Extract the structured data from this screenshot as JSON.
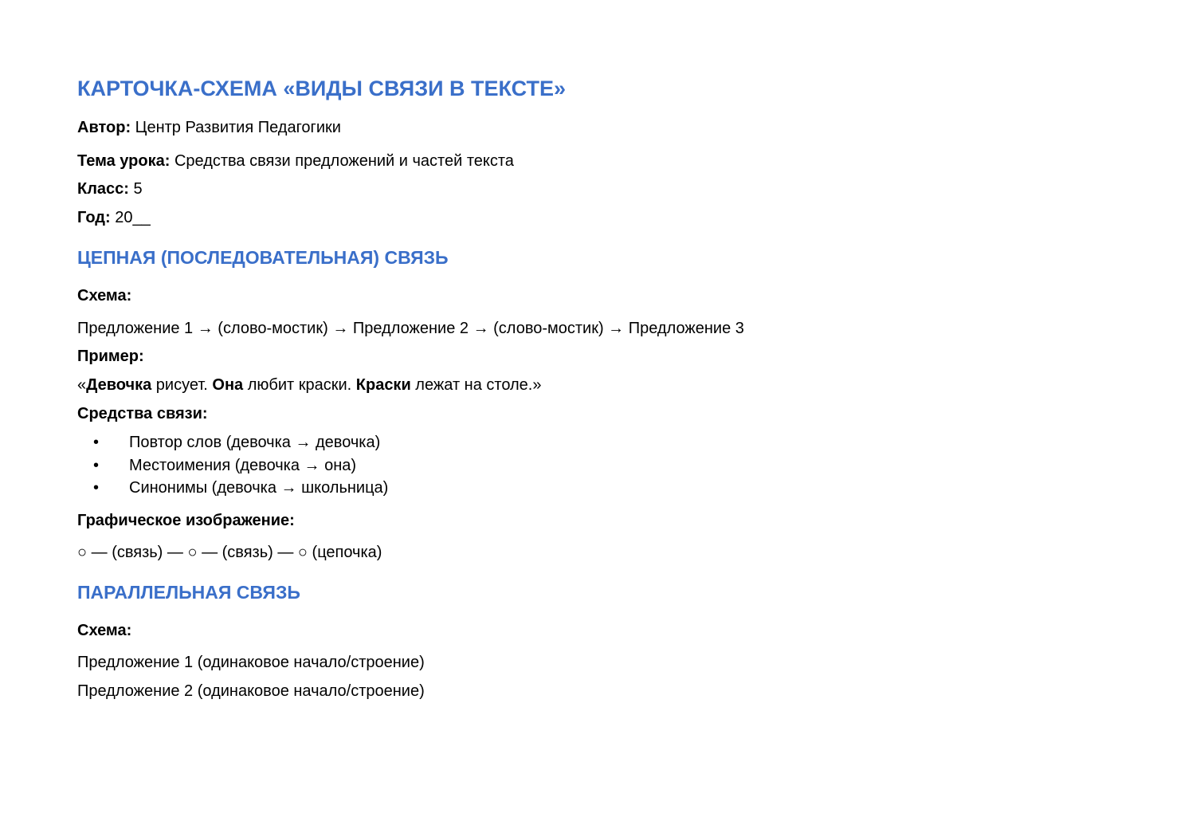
{
  "title": "КАРТОЧКА-СХЕМА «ВИДЫ СВЯЗИ В ТЕКСТЕ»",
  "meta": {
    "author_label": "Автор:",
    "author_value": " Центр Развития Педагогики",
    "topic_label": "Тема урока:",
    "topic_value": " Средства связи предложений и частей текста",
    "class_label": "Класс:",
    "class_value": " 5",
    "year_label": "Год:",
    "year_value": " 20__"
  },
  "section1": {
    "heading": "ЦЕПНАЯ (ПОСЛЕДОВАТЕЛЬНАЯ) СВЯЗЬ",
    "scheme_label": "Схема:",
    "scheme_text": "Предложение 1 → (слово-мостик) → Предложение 2 → (слово-мостик) → Предложение 3",
    "example_label": "Пример:",
    "example": {
      "open_quote": "«",
      "w1": "Девочка",
      "t1": " рисует. ",
      "w2": "Она",
      "t2": " любит краски. ",
      "w3": "Краски",
      "t3": " лежат на столе.»"
    },
    "means_label": "Средства связи:",
    "bullet_char": "•",
    "means": [
      "Повтор слов (девочка → девочка)",
      "Местоимения (девочка → она)",
      "Синонимы (девочка → школьница)"
    ],
    "graphic_label": "Графическое изображение:",
    "graphic_text": "○ — (связь) — ○ — (связь) — ○ (цепочка)"
  },
  "section2": {
    "heading": "ПАРАЛЛЕЛЬНАЯ СВЯЗЬ",
    "scheme_label": "Схема:",
    "lines": [
      "Предложение 1 (одинаковое начало/строение)",
      "Предложение 2 (одинаковое начало/строение)"
    ]
  }
}
